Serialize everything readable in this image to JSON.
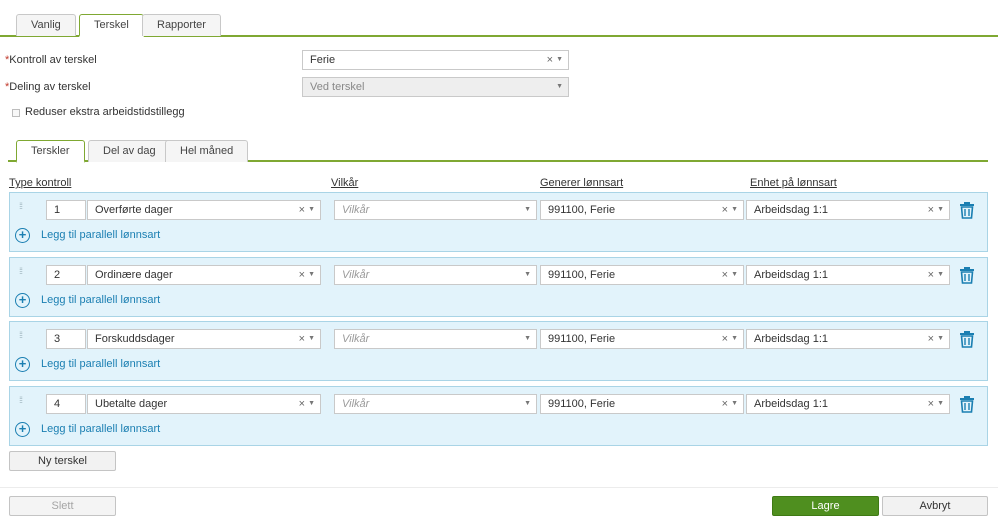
{
  "tabs": [
    "Vanlig",
    "Terskel",
    "Rapporter"
  ],
  "form": {
    "kontroll_label": "Kontroll av terskel",
    "kontroll_value": "Ferie",
    "deling_label": "Deling av terskel",
    "deling_value": "Ved terskel",
    "required_mark": "*",
    "reduser_label": "Reduser ekstra arbeidstidstillegg"
  },
  "inner_tabs": [
    "Terskler",
    "Del av dag",
    "Hel måned"
  ],
  "columns": {
    "type": "Type kontroll",
    "vilkar": "Vilkår",
    "generer": "Generer lønnsart",
    "enhet": "Enhet på lønnsart"
  },
  "rows": [
    {
      "num": "1",
      "type": "Overførte dager",
      "vilkar_placeholder": "Vilkår",
      "lonnsart": "991100, Ferie",
      "enhet": "Arbeidsdag 1:1",
      "add_label": "Legg til parallell lønnsart"
    },
    {
      "num": "2",
      "type": "Ordinære dager",
      "vilkar_placeholder": "Vilkår",
      "lonnsart": "991100, Ferie",
      "enhet": "Arbeidsdag 1:1",
      "add_label": "Legg til parallell lønnsart"
    },
    {
      "num": "3",
      "type": "Forskuddsdager",
      "vilkar_placeholder": "Vilkår",
      "lonnsart": "991100, Ferie",
      "enhet": "Arbeidsdag 1:1",
      "add_label": "Legg til parallell lønnsart"
    },
    {
      "num": "4",
      "type": "Ubetalte dager",
      "vilkar_placeholder": "Vilkår",
      "lonnsart": "991100, Ferie",
      "enhet": "Arbeidsdag 1:1",
      "add_label": "Legg til parallell lønnsart"
    }
  ],
  "buttons": {
    "ny_terskel": "Ny terskel",
    "slett": "Slett",
    "lagre": "Lagre",
    "avbryt": "Avbryt"
  },
  "glyphs": {
    "clear": "×",
    "caret": "▼",
    "plus": "+"
  },
  "colors": {
    "accent_green": "#7fa832",
    "primary_button": "#4f8f1f",
    "row_bg": "#e2f3fb",
    "link_blue": "#1b7fb2"
  }
}
